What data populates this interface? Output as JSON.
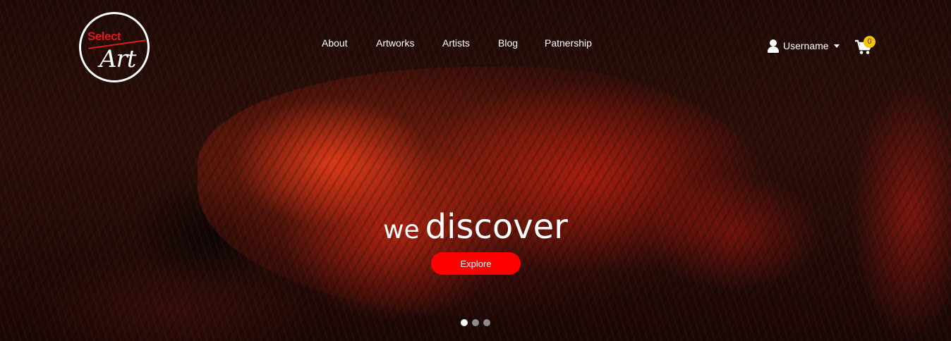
{
  "logo": {
    "top_text": "Select",
    "bottom_text": "Art"
  },
  "nav": {
    "items": [
      {
        "label": "About"
      },
      {
        "label": "Artworks"
      },
      {
        "label": "Artists"
      },
      {
        "label": "Blog"
      },
      {
        "label": "Patnership"
      }
    ]
  },
  "user": {
    "name": "Username",
    "icon": "user-icon"
  },
  "cart": {
    "count": "0",
    "icon": "cart-icon",
    "badge_color": "#f5c400"
  },
  "hero": {
    "headline_small": "we",
    "headline_big": "discover",
    "button_label": "Explore",
    "button_color": "#ff0000"
  },
  "carousel": {
    "slides": 3,
    "active_index": 0
  }
}
